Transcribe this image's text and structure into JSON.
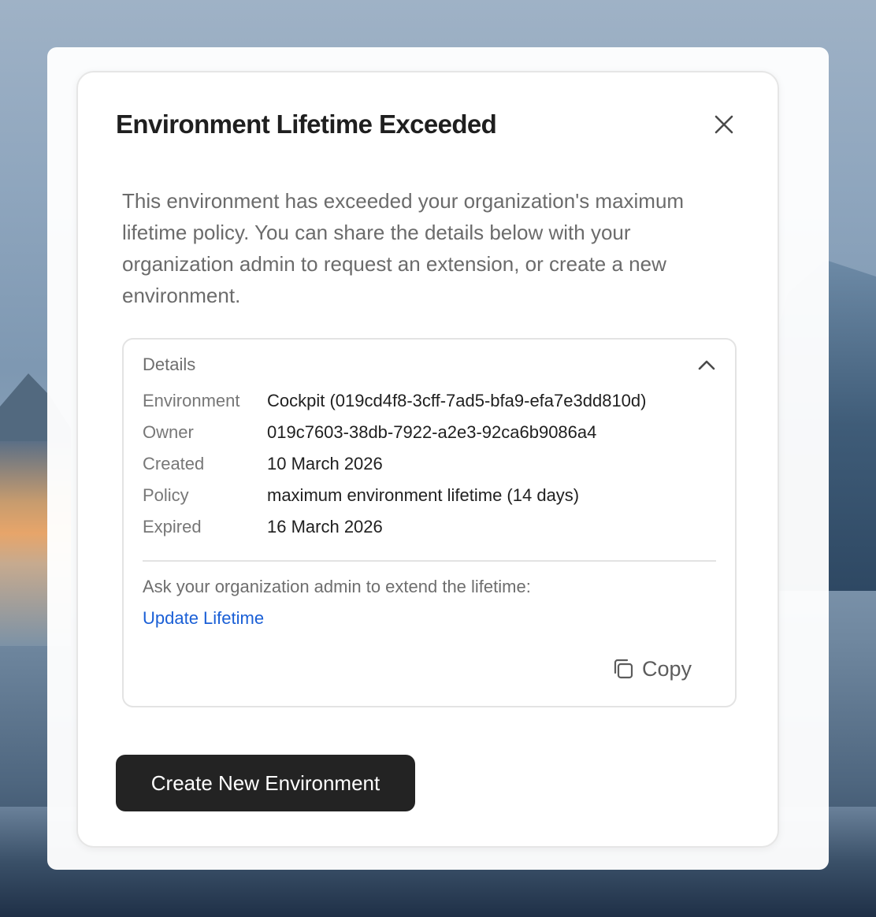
{
  "dialog": {
    "title": "Environment Lifetime Exceeded",
    "close_icon": "close-icon",
    "description": "This environment has exceeded your organization's maximum lifetime policy. You can share the details below with your organization admin to request an extension, or create a new environment."
  },
  "details": {
    "title": "Details",
    "expanded": true,
    "toggle_icon": "chevron-up-icon",
    "rows": [
      {
        "label": "Environment",
        "value": "Cockpit (019cd4f8-3cff-7ad5-bfa9-efa7e3dd810d)"
      },
      {
        "label": "Owner",
        "value": "019c7603-38db-7922-a2e3-92ca6b9086a4"
      },
      {
        "label": "Created",
        "value": "10 March 2026"
      },
      {
        "label": "Policy",
        "value": "maximum environment lifetime (14 days)"
      },
      {
        "label": "Expired",
        "value": "16 March 2026"
      }
    ],
    "ask_text": "Ask your organization admin to extend the lifetime:",
    "link_label": "Update Lifetime",
    "copy_label": "Copy",
    "copy_icon": "copy-icon"
  },
  "actions": {
    "create_label": "Create New Environment"
  },
  "colors": {
    "primary_button": "#232323",
    "link": "#1a5fd6"
  }
}
